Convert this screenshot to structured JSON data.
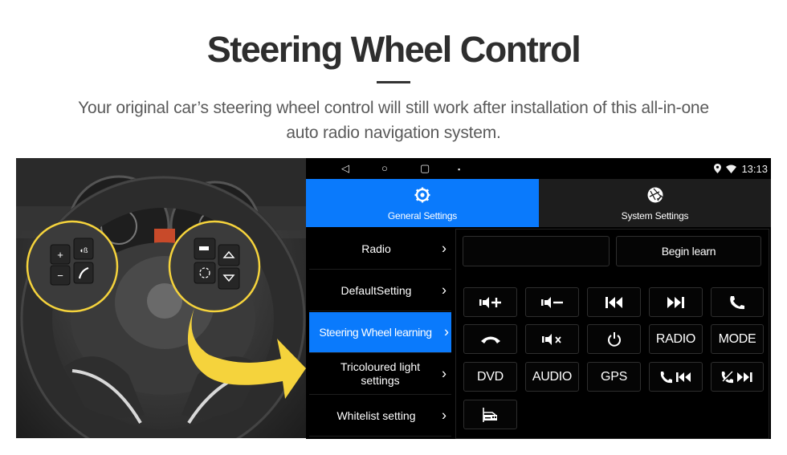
{
  "page": {
    "title": "Steering Wheel Control",
    "subtitle_line1": "Your original car’s steering wheel control will still work after installation of this all-in-one",
    "subtitle_line2": "auto radio navigation system."
  },
  "photo": {
    "description": "steering-wheel-photo",
    "left_controls": [
      "volume-up",
      "voice",
      "volume-down",
      "phone-answer"
    ],
    "right_controls": [
      "mode",
      "up",
      "source",
      "down"
    ],
    "accent_color": "#f5d33c"
  },
  "statusbar": {
    "nav_icons": [
      "back-icon",
      "home-icon",
      "recents-icon",
      "screenshot-icon"
    ],
    "status_icons": [
      "location-icon",
      "wifi-icon"
    ],
    "time": "13:13"
  },
  "tabs": [
    {
      "label": "General Settings",
      "icon": "gear-icon",
      "active": true
    },
    {
      "label": "System Settings",
      "icon": "system-globe-icon",
      "active": false
    }
  ],
  "menu": {
    "items": [
      {
        "label": "Radio",
        "active": false
      },
      {
        "label": "DefaultSetting",
        "active": false
      },
      {
        "label": "Steering Wheel learning",
        "active": true
      },
      {
        "label": "Tricoloured light settings",
        "active": false
      },
      {
        "label": "Whitelist setting",
        "active": false
      }
    ],
    "chevron": "›"
  },
  "panel": {
    "status_field": "",
    "begin_learn_label": "Begin learn",
    "buttons": [
      {
        "label": "",
        "icon": "volume-up-icon"
      },
      {
        "label": "",
        "icon": "volume-down-icon"
      },
      {
        "label": "",
        "icon": "previous-track-icon"
      },
      {
        "label": "",
        "icon": "next-track-icon"
      },
      {
        "label": "",
        "icon": "phone-answer-icon"
      },
      {
        "label": "",
        "icon": "phone-hangup-icon"
      },
      {
        "label": "",
        "icon": "mute-icon"
      },
      {
        "label": "",
        "icon": "power-icon"
      },
      {
        "label": "RADIO",
        "icon": ""
      },
      {
        "label": "MODE",
        "icon": ""
      },
      {
        "label": "DVD",
        "icon": ""
      },
      {
        "label": "AUDIO",
        "icon": ""
      },
      {
        "label": "GPS",
        "icon": ""
      },
      {
        "label": "",
        "icon": "phone-previous-icon"
      },
      {
        "label": "",
        "icon": "hangup-next-icon"
      },
      {
        "label": "",
        "icon": "car-icon"
      }
    ]
  },
  "colors": {
    "accent_blue": "#0a7afc",
    "highlight_yellow": "#f5d33c",
    "screen_bg": "#000000"
  }
}
